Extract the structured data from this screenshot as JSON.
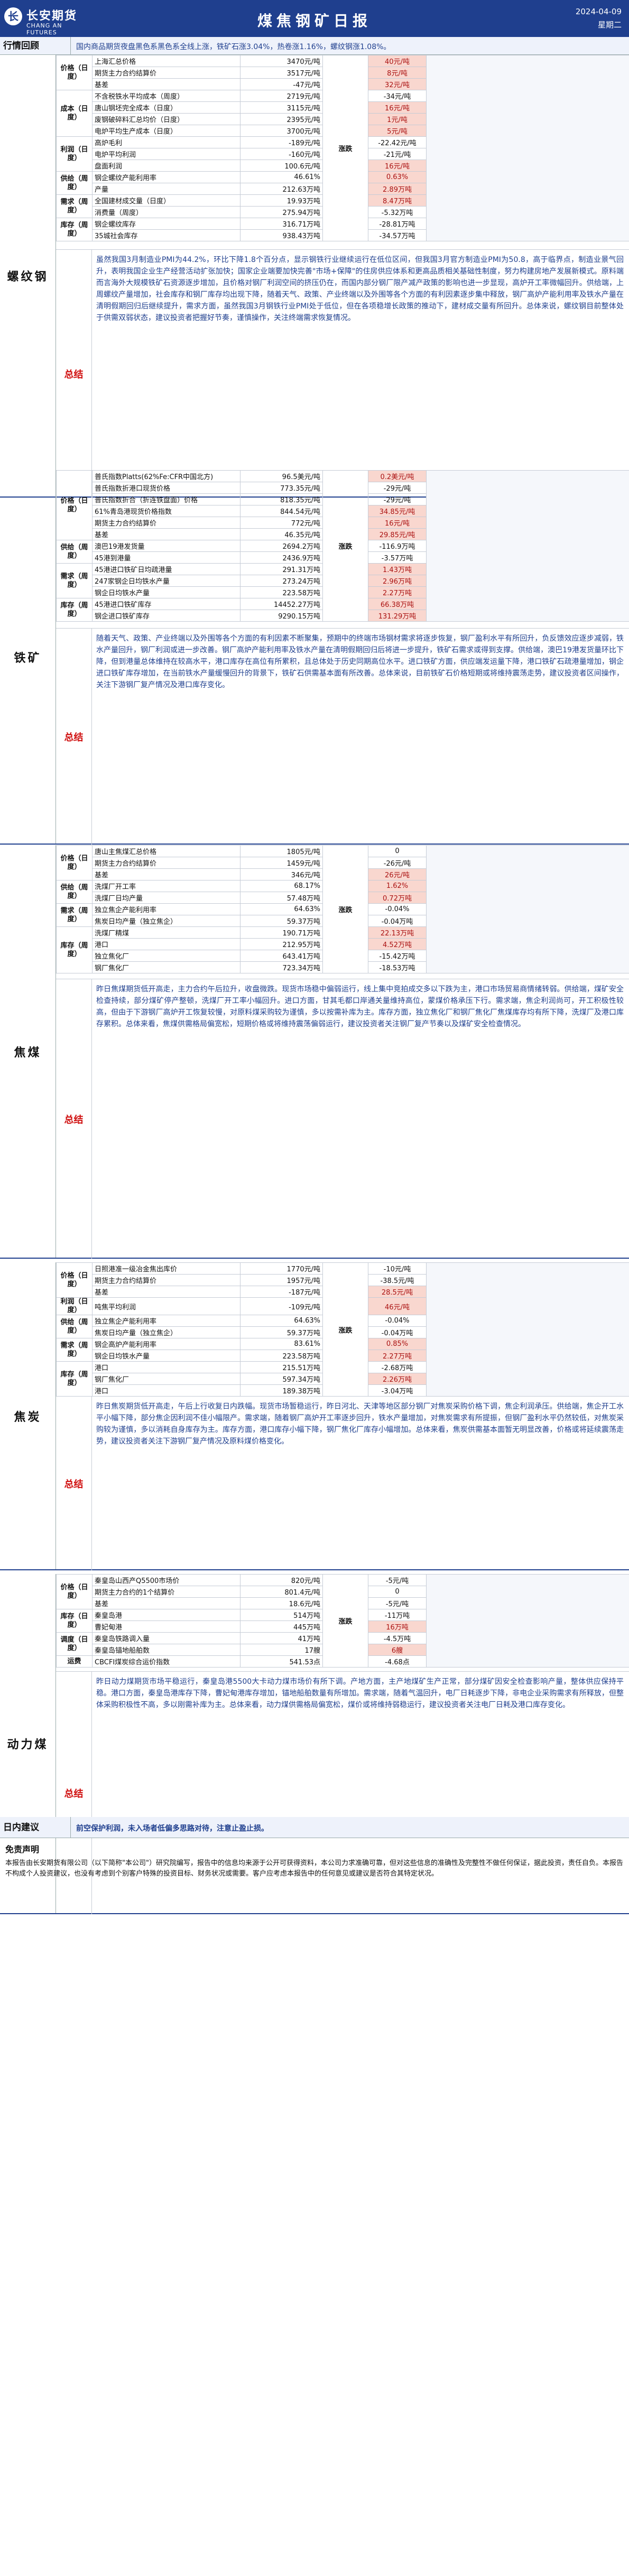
{
  "header": {
    "logo_cn": "长安期货",
    "logo_en": "CHANG AN FUTURES",
    "title": "煤焦钢矿日报",
    "date": "2024-04-09",
    "weekday": "星期二"
  },
  "review": {
    "label": "行情回顾",
    "text": "国内商品期货夜盘黑色系黑色系全线上涨，铁矿石涨3.04%，热卷涨1.16%，螺纹钢涨1.08%。"
  },
  "colors": {
    "up_bg": "#f9d7cf",
    "down_bg": "#d8eed2",
    "brand": "#1f3f8e"
  },
  "sections": [
    {
      "name": "螺纹钢",
      "trend": "涨跌",
      "rows": [
        {
          "cat": "价格（日度）",
          "item": "上海汇总价格",
          "value": "3470元/吨",
          "change": "40元/吨",
          "dir": "up"
        },
        {
          "cat": "",
          "item": "期货主力合约结算价",
          "value": "3517元/吨",
          "change": "8元/吨",
          "dir": "up"
        },
        {
          "cat": "",
          "item": "基差",
          "value": "-47元/吨",
          "change": "32元/吨",
          "dir": "up"
        },
        {
          "cat": "成本（日度）",
          "item": "不含税铁水平均成本（周度）",
          "value": "2719元/吨",
          "change": "-34元/吨",
          "dir": "down"
        },
        {
          "cat": "",
          "item": "唐山钢坯完全成本（日度）",
          "value": "3115元/吨",
          "change": "16元/吨",
          "dir": "up"
        },
        {
          "cat": "",
          "item": "废钢破碎料汇总均价（日度）",
          "value": "2395元/吨",
          "change": "1元/吨",
          "dir": "up"
        },
        {
          "cat": "",
          "item": "电炉平均生产成本（日度）",
          "value": "3700元/吨",
          "change": "5元/吨",
          "dir": "up"
        },
        {
          "cat": "利润（日度）",
          "item": "高炉毛利",
          "value": "-189元/吨",
          "change": "-22.42元/吨",
          "dir": "down"
        },
        {
          "cat": "",
          "item": "电炉平均利润",
          "value": "-160元/吨",
          "change": "-21元/吨",
          "dir": "down"
        },
        {
          "cat": "",
          "item": "盘面利润",
          "value": "100.6元/吨",
          "change": "16元/吨",
          "dir": "up"
        },
        {
          "cat": "供给（周度）",
          "item": "钢企螺纹产能利用率",
          "value": "46.61%",
          "change": "0.63%",
          "dir": "up"
        },
        {
          "cat": "",
          "item": "产量",
          "value": "212.63万吨",
          "change": "2.89万吨",
          "dir": "up"
        },
        {
          "cat": "需求（周度）",
          "item": "全国建材成交量（日度）",
          "value": "19.93万吨",
          "change": "8.47万吨",
          "dir": "up"
        },
        {
          "cat": "",
          "item": "消费量（周度）",
          "value": "275.94万吨",
          "change": "-5.32万吨",
          "dir": "down"
        },
        {
          "cat": "库存（周度）",
          "item": "钢企螺纹库存",
          "value": "316.71万吨",
          "change": "-28.81万吨",
          "dir": "down"
        },
        {
          "cat": "",
          "item": "35城社会库存",
          "value": "938.43万吨",
          "change": "-34.57万吨",
          "dir": "down"
        }
      ],
      "summary": "虽然我国3月制造业PMI为44.2%，环比下降1.8个百分点，显示钢铁行业继续运行在低位区间，但我国3月官方制造业PMI为50.8，高于临界点，制造业景气回升，表明我国企业生产经营活动扩张加快；国家企业端要加快完善\"市场+保障\"的住房供应体系和更高品质相关基础性制度，努力构建房地产发展新模式。原料端而言海外大规模铁矿石资源逐步增加，且价格对钢厂利润空间的挤压仍在，而国内部分钢厂限产减产政策的影响也进一步显现，高炉开工率微幅回升。供给端，上周螺纹产量增加，社会库存和钢厂库存均出现下降，随着天气、政策、产业终端以及外围等各个方面的有利因素逐步集中释放，钢厂高炉产能利用率及铁水产量在清明假期回归后继续提升，需求方面，虽然我国3月钢铁行业PMI处于低位，但在各项稳增长政策的推动下，建材成交量有所回升。总体来说，螺纹钢目前整体处于供需双弱状态，建议投资者把握好节奏，谨慎操作，关注终端需求恢复情况。"
    },
    {
      "name": "铁矿",
      "trend": "涨跌",
      "rows": [
        {
          "cat": "价格（日度）",
          "item": "普氏指数Platts(62%Fe:CFR中国北方)",
          "value": "96.5美元/吨",
          "change": "0.2美元/吨",
          "dir": "up"
        },
        {
          "cat": "",
          "item": "普氏指数折港口现货价格",
          "value": "773.35元/吨",
          "change": "-29元/吨",
          "dir": "down"
        },
        {
          "cat": "",
          "item": "普氏指数折合（折连铁盘面）价格",
          "value": "818.35元/吨",
          "change": "-29元/吨",
          "dir": "down"
        },
        {
          "cat": "",
          "item": "61%青岛港现货价格指数",
          "value": "844.54元/吨",
          "change": "34.85元/吨",
          "dir": "up"
        },
        {
          "cat": "",
          "item": "期货主力合约结算价",
          "value": "772元/吨",
          "change": "16元/吨",
          "dir": "up"
        },
        {
          "cat": "",
          "item": "基差",
          "value": "46.35元/吨",
          "change": "29.85元/吨",
          "dir": "up"
        },
        {
          "cat": "供给（周度）",
          "item": "澳巴19港发货量",
          "value": "2694.2万吨",
          "change": "-116.9万吨",
          "dir": "down"
        },
        {
          "cat": "",
          "item": "45港到港量",
          "value": "2436.9万吨",
          "change": "-3.57万吨",
          "dir": "down"
        },
        {
          "cat": "需求（周度）",
          "item": "45港进口铁矿日均疏港量",
          "value": "291.31万吨",
          "change": "1.43万吨",
          "dir": "up"
        },
        {
          "cat": "",
          "item": "247家钢企日均铁水产量",
          "value": "273.24万吨",
          "change": "2.96万吨",
          "dir": "up"
        },
        {
          "cat": "",
          "item": "钢企日均铁水产量",
          "value": "223.58万吨",
          "change": "2.27万吨",
          "dir": "up"
        },
        {
          "cat": "库存（周度）",
          "item": "45港进口铁矿库存",
          "value": "14452.27万吨",
          "change": "66.38万吨",
          "dir": "up"
        },
        {
          "cat": "",
          "item": "钢企进口铁矿库存",
          "value": "9290.15万吨",
          "change": "131.29万吨",
          "dir": "up"
        }
      ],
      "summary": "随着天气、政策、产业终端以及外围等各个方面的有利因素不断聚集，预期中的终端市场钢材需求将逐步恢复，钢厂盈利水平有所回升，负反馈效应逐步减弱，铁水产量回升，钢厂利润或进一步改善。钢厂高炉产能利用率及铁水产量在清明假期回归后将进一步提升，铁矿石需求或得到支撑。供给端，澳巴19港发货量环比下降，但到港量总体维持在较高水平，港口库存在高位有所累积，且总体处于历史同期高位水平。进口铁矿方面，供应端发运量下降，港口铁矿石疏港量增加，钢企进口铁矿库存增加，在当前铁水产量缓慢回升的背景下，铁矿石供需基本面有所改善。总体来说，目前铁矿石价格短期或将维持震荡走势，建议投资者区间操作，关注下游钢厂复产情况及港口库存变化。"
    },
    {
      "name": "焦煤",
      "trend": "涨跌",
      "rows": [
        {
          "cat": "价格（日度）",
          "item": "唐山主焦煤汇总价格",
          "value": "1805元/吨",
          "change": "0",
          "dir": "eq"
        },
        {
          "cat": "",
          "item": "期货主力合约结算价",
          "value": "1459元/吨",
          "change": "-26元/吨",
          "dir": "down"
        },
        {
          "cat": "",
          "item": "基差",
          "value": "346元/吨",
          "change": "26元/吨",
          "dir": "up"
        },
        {
          "cat": "供给（周度）",
          "item": "洗煤厂开工率",
          "value": "68.17%",
          "change": "1.62%",
          "dir": "up"
        },
        {
          "cat": "",
          "item": "洗煤厂日均产量",
          "value": "57.48万吨",
          "change": "0.72万吨",
          "dir": "up"
        },
        {
          "cat": "需求（周度）",
          "item": "独立焦企产能利用率",
          "value": "64.63%",
          "change": "-0.04%",
          "dir": "down"
        },
        {
          "cat": "",
          "item": "焦炭日均产量（独立焦企）",
          "value": "59.37万吨",
          "change": "-0.04万吨",
          "dir": "down"
        },
        {
          "cat": "库存（周度）",
          "item": "洗煤厂精煤",
          "value": "190.71万吨",
          "change": "22.13万吨",
          "dir": "up"
        },
        {
          "cat": "",
          "item": "港口",
          "value": "212.95万吨",
          "change": "4.52万吨",
          "dir": "up"
        },
        {
          "cat": "",
          "item": "独立焦化厂",
          "value": "643.41万吨",
          "change": "-15.42万吨",
          "dir": "down"
        },
        {
          "cat": "",
          "item": "钢厂焦化厂",
          "value": "723.34万吨",
          "change": "-18.53万吨",
          "dir": "down"
        }
      ],
      "summary": "昨日焦煤期货低开高走，主力合约午后拉升，收盘微跌。现货市场稳中偏弱运行，线上集中竞拍成交多以下跌为主，港口市场贸易商情绪转弱。供给端，煤矿安全检查持续，部分煤矿停产整顿，洗煤厂开工率小幅回升。进口方面，甘其毛都口岸通关量维持高位，蒙煤价格承压下行。需求端，焦企利润尚可，开工积极性较高，但由于下游钢厂高炉开工恢复较慢，对原料煤采购较为谨慎，多以按需补库为主。库存方面，独立焦化厂和钢厂焦化厂焦煤库存均有所下降，洗煤厂及港口库存累积。总体来看，焦煤供需格局偏宽松，短期价格或将维持震荡偏弱运行，建议投资者关注钢厂复产节奏以及煤矿安全检查情况。"
    },
    {
      "name": "焦炭",
      "trend": "涨跌",
      "rows": [
        {
          "cat": "价格（日度）",
          "item": "日照港准一级冶金焦出库价",
          "value": "1770元/吨",
          "change": "-10元/吨",
          "dir": "down"
        },
        {
          "cat": "",
          "item": "期货主力合约结算价",
          "value": "1957元/吨",
          "change": "-38.5元/吨",
          "dir": "down"
        },
        {
          "cat": "",
          "item": "基差",
          "value": "-187元/吨",
          "change": "28.5元/吨",
          "dir": "up"
        },
        {
          "cat": "利润（日度）",
          "item": "吨焦平均利润",
          "value": "-109元/吨",
          "change": "46元/吨",
          "dir": "up"
        },
        {
          "cat": "供给（周度）",
          "item": "独立焦企产能利用率",
          "value": "64.63%",
          "change": "-0.04%",
          "dir": "down"
        },
        {
          "cat": "",
          "item": "焦炭日均产量（独立焦企）",
          "value": "59.37万吨",
          "change": "-0.04万吨",
          "dir": "down"
        },
        {
          "cat": "需求（周度）",
          "item": "钢企高炉产能利用率",
          "value": "83.61%",
          "change": "0.85%",
          "dir": "up"
        },
        {
          "cat": "",
          "item": "钢企日均铁水产量",
          "value": "223.58万吨",
          "change": "2.27万吨",
          "dir": "up"
        },
        {
          "cat": "库存（周度）",
          "item": "港口",
          "value": "215.51万吨",
          "change": "-2.68万吨",
          "dir": "down"
        },
        {
          "cat": "",
          "item": "钢厂焦化厂",
          "value": "597.34万吨",
          "change": "2.26万吨",
          "dir": "up"
        },
        {
          "cat": "",
          "item": "港口",
          "value": "189.38万吨",
          "change": "-3.04万吨",
          "dir": "down"
        }
      ],
      "summary": "昨日焦炭期货低开高走，午后上行收复日内跌幅。现货市场暂稳运行，昨日河北、天津等地区部分钢厂对焦炭采购价格下调，焦企利润承压。供给端，焦企开工水平小幅下降，部分焦企因利润不佳小幅限产。需求端，随着钢厂高炉开工率逐步回升，铁水产量增加，对焦炭需求有所提振，但钢厂盈利水平仍然较低，对焦炭采购较为谨慎，多以消耗自身库存为主。库存方面，港口库存小幅下降，钢厂焦化厂库存小幅增加。总体来看，焦炭供需基本面暂无明显改善，价格或将延续震荡走势，建议投资者关注下游钢厂复产情况及原料煤价格变化。"
    },
    {
      "name": "动力煤",
      "trend": "涨跌",
      "rows": [
        {
          "cat": "价格（日度）",
          "item": "秦皇岛山西产Q5500市场价",
          "value": "820元/吨",
          "change": "-5元/吨",
          "dir": "down"
        },
        {
          "cat": "",
          "item": "期货主力合约的1个结算价",
          "value": "801.4元/吨",
          "change": "0",
          "dir": "eq"
        },
        {
          "cat": "",
          "item": "基差",
          "value": "18.6元/吨",
          "change": "-5元/吨",
          "dir": "down"
        },
        {
          "cat": "库存（日度）",
          "item": "秦皇岛港",
          "value": "514万吨",
          "change": "-11万吨",
          "dir": "down"
        },
        {
          "cat": "",
          "item": "曹妃甸港",
          "value": "445万吨",
          "change": "16万吨",
          "dir": "up"
        },
        {
          "cat": "调度（日度）",
          "item": "秦皇岛铁路调入量",
          "value": "41万吨",
          "change": "-4.5万吨",
          "dir": "down"
        },
        {
          "cat": "",
          "item": "秦皇岛锚地船舶数",
          "value": "17艘",
          "change": "6艘",
          "dir": "up"
        },
        {
          "cat": "运费",
          "item": "CBCFI煤炭综合运价指数",
          "value": "541.53点",
          "change": "-4.68点",
          "dir": "down"
        }
      ],
      "summary": "昨日动力煤期货市场平稳运行，秦皇岛港5500大卡动力煤市场价有所下调。产地方面，主产地煤矿生产正常，部分煤矿因安全检查影响产量，整体供应保持平稳。港口方面，秦皇岛港库存下降，曹妃甸港库存增加，锚地船舶数量有所增加。需求端，随着气温回升，电厂日耗逐步下降，非电企业采购需求有所释放，但整体采购积极性不高，多以刚需补库为主。总体来看，动力煤供需格局偏宽松，煤价或将维持弱稳运行，建议投资者关注电厂日耗及港口库存变化。"
    }
  ],
  "advice": {
    "label": "日内建议",
    "text": "前空保护利润，未入场者低偏多思路对待，注意止盈止损。"
  },
  "disclaimer": {
    "title": "免责声明",
    "text": "本报告由长安期货有限公司（以下简称\"本公司\"）研究院编写，报告中的信息均来源于公开可获得资料，本公司力求准确可靠，但对这些信息的准确性及完整性不做任何保证，据此投资，责任自负。本报告不构成个人投资建议，也没有考虑到个别客户特殊的投资目标、财务状况或需要。客户应考虑本报告中的任何意见或建议是否符合其特定状况。"
  }
}
